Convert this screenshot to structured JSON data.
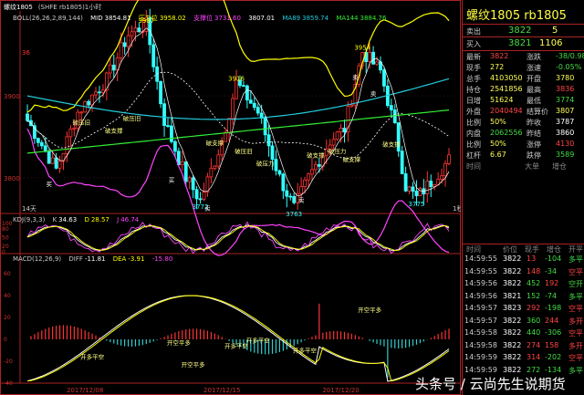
{
  "top": {
    "label": "螺纹1805",
    "subtitle": "(SHFE rb1805)1小时"
  },
  "boll": {
    "label": "BOLL(26,26,2,89,144)",
    "mid_label": "MID",
    "mid": "3854.81",
    "upper_label": "压力位",
    "upper": "3958.02",
    "lower_label": "支撑位",
    "lower": "3731.60",
    "ma_label": "",
    "ma": "3807.01",
    "ma89_label": "MA89",
    "ma89": "3859.74",
    "ma144_label": "MA144",
    "ma144": "3884.76"
  },
  "main_chart": {
    "y_ticks": [
      "3900",
      "3800"
    ],
    "peak_labels": [
      "3987",
      "3954",
      "3916",
      "3772",
      "3763",
      "3775",
      "36"
    ],
    "signal_labels": [
      "破压旧",
      "破支撑",
      "破压旧",
      "破支撑",
      "破压旧",
      "破压力",
      "破支撑",
      "破压力",
      "破支撑",
      "破支撑",
      "卖",
      "卖",
      "买",
      "买",
      "卖",
      "卖"
    ],
    "period_label": "14天",
    "scale_right": "1秒"
  },
  "kdj": {
    "label": "KDJ(9,3,3)",
    "k_label": "K",
    "k": "34.63",
    "d_label": "D",
    "d": "28.57",
    "j_label": "J",
    "j": "46.74",
    "y_ticks": [
      "100",
      "80",
      "50",
      "20",
      "0"
    ]
  },
  "macd": {
    "label": "MACD(12,26,9)",
    "diff_label": "DIFF",
    "diff": "-11.81",
    "dea_label": "DEA",
    "dea": "-3.91",
    "m_label": "",
    "m": "-15.80",
    "y_ticks": [
      "60",
      "40",
      "20",
      "0",
      "-20",
      "-40"
    ],
    "signals": [
      "开空平多",
      "开多平空",
      "开空平多",
      "开多平空",
      "开多平空",
      "开空平多",
      "开多平空"
    ]
  },
  "x_axis": {
    "dates": [
      "2017/12/08",
      "2017/12/15",
      "2017/12/20"
    ]
  },
  "panel": {
    "title": "螺纹1805 rb1805",
    "sell_label": "卖出",
    "sell_price": "3822",
    "sell_vol": "5",
    "buy_label": "买入",
    "buy_price": "3821",
    "buy_vol": "1106",
    "stats": [
      {
        "l1": "最新",
        "v1": "3822",
        "c1": "#ff4444",
        "l2": "涨跌",
        "v2": "-38/0.98%",
        "c2": "#44dd44"
      },
      {
        "l1": "现手",
        "v1": "272",
        "c1": "#ffff55",
        "l2": "涨速",
        "v2": "-0.05%",
        "c2": "#44dd44"
      },
      {
        "l1": "总手",
        "v1": "4103050",
        "c1": "#ffff55",
        "l2": "开盘",
        "v2": "3780",
        "c2": "#ffff55"
      },
      {
        "l1": "持仓",
        "v1": "2541856",
        "c1": "#ffff55",
        "l2": "最高",
        "v2": "3836",
        "c2": "#ff4444"
      },
      {
        "l1": "日增",
        "v1": "51624",
        "c1": "#ffff55",
        "l2": "最低",
        "v2": "3774",
        "c2": "#44dd44"
      },
      {
        "l1": "外盘",
        "v1": "2040494",
        "c1": "#ff4444",
        "l2": "结算价",
        "v2": "3807",
        "c2": "#ffff55"
      },
      {
        "l1": "比例",
        "v1": "50%",
        "c1": "#ffff55",
        "l2": "昨收",
        "v2": "3787",
        "c2": "#ffffff"
      },
      {
        "l1": "内盘",
        "v1": "2062556",
        "c1": "#44dd44",
        "l2": "昨结",
        "v2": "3860",
        "c2": "#ffffff"
      },
      {
        "l1": "比例",
        "v1": "50%",
        "c1": "#ffff55",
        "l2": "涨停",
        "v2": "4130",
        "c2": "#ff4444"
      },
      {
        "l1": "杠杆",
        "v1": "6.67",
        "c1": "#ffff55",
        "l2": "跌停",
        "v2": "3589",
        "c2": "#44dd44"
      }
    ],
    "tick_headers": [
      "时间",
      "大单",
      "增仓"
    ],
    "tick_headers2": [
      "时间",
      "价位",
      "现手",
      "增仓",
      "开平"
    ],
    "ticks": [
      {
        "t": "14:59:55",
        "p": "3822",
        "v": "13",
        "z": "-104",
        "o": "多平",
        "vc": "#ff4444",
        "zc": "#44dd44",
        "oc": "#44dd44"
      },
      {
        "t": "14:59:55",
        "p": "3822",
        "v": "148",
        "z": "-34",
        "o": "空平",
        "vc": "#ff4444",
        "zc": "#44dd44",
        "oc": "#ff4444"
      },
      {
        "t": "14:59:56",
        "p": "3822",
        "v": "452",
        "z": "192",
        "o": "空开",
        "vc": "#44dd44",
        "zc": "#ff4444",
        "oc": "#44dd44"
      },
      {
        "t": "14:59:56",
        "p": "3821",
        "v": "152",
        "z": "-74",
        "o": "多平",
        "vc": "#44dd44",
        "zc": "#44dd44",
        "oc": "#44dd44"
      },
      {
        "t": "14:59:57",
        "p": "3823",
        "v": "292",
        "z": "-198",
        "o": "空平",
        "vc": "#ff4444",
        "zc": "#44dd44",
        "oc": "#ff4444"
      },
      {
        "t": "14:59:57",
        "p": "3822",
        "v": "360",
        "z": "244",
        "o": "多开",
        "vc": "#44dd44",
        "zc": "#ff4444",
        "oc": "#ff4444"
      },
      {
        "t": "14:59:58",
        "p": "3822",
        "v": "440",
        "z": "-306",
        "o": "空平",
        "vc": "#44dd44",
        "zc": "#44dd44",
        "oc": "#ff4444"
      },
      {
        "t": "14:59:58",
        "p": "3822",
        "v": "274",
        "z": "158",
        "o": "多开",
        "vc": "#ff4444",
        "zc": "#ff4444",
        "oc": "#ff4444"
      },
      {
        "t": "14:59:59",
        "p": "3822",
        "v": "314",
        "z": "-202",
        "o": "空平",
        "vc": "#ff4444",
        "zc": "#44dd44",
        "oc": "#ff4444"
      },
      {
        "t": "14:59:59",
        "p": "3822",
        "v": "272",
        "z": "-134",
        "o": "多平",
        "vc": "#44dd44",
        "zc": "#44dd44",
        "oc": "#44dd44"
      }
    ]
  },
  "watermark": "头条号 / 云尚先生说期货",
  "colors": {
    "up": "#ff3333",
    "down": "#33ffff",
    "upper": "#ffff00",
    "mid": "#ffffff",
    "ma89": "#22ccdd",
    "ma144": "#33ee33",
    "lower": "#ff44ff",
    "frame": "#aa2222"
  }
}
